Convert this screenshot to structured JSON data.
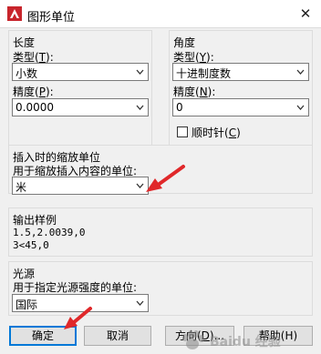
{
  "window": {
    "title": "图形单位",
    "close_glyph": "✕"
  },
  "length": {
    "group_title": "长度",
    "type_label": "类型(",
    "type_key": "T",
    "type_value": "小数",
    "precision_label": "精度(",
    "precision_key": "P",
    "precision_value": "0.0000"
  },
  "angle": {
    "group_title": "角度",
    "type_label": "类型(",
    "type_key": "Y",
    "type_value": "十进制度数",
    "precision_label": "精度(",
    "precision_key": "N",
    "precision_value": "0",
    "clockwise_label": "顺时针(",
    "clockwise_key": "C",
    "clockwise_checked": false
  },
  "insertion": {
    "group_title": "插入时的缩放单位",
    "desc": "用于缩放插入内容的单位:",
    "value": "米"
  },
  "sample": {
    "group_title": "输出样例",
    "lines": [
      "1.5,2.0039,0",
      "3<45,0"
    ]
  },
  "lighting": {
    "group_title": "光源",
    "desc": "用于指定光源强度的单位:",
    "value": "国际"
  },
  "buttons": {
    "ok": "确定",
    "cancel": "取消",
    "direction": "方向(",
    "direction_key": "D",
    "help": "帮助(H)"
  },
  "watermark_text": "Baidu 经验",
  "colors": {
    "accent": "#0078d7",
    "arrow": "#e0282a",
    "app_icon": "#c8252c"
  },
  "icons": [
    "autocad-app-icon",
    "close-icon",
    "chevron-down-icon",
    "red-pointer-arrow",
    "baidu-paw-icon"
  ]
}
